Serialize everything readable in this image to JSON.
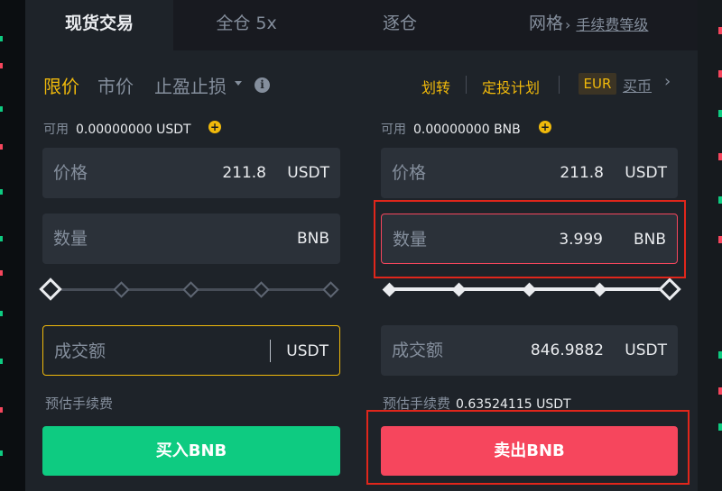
{
  "colors": {
    "accent": "#f0b90b",
    "buy": "#0ecb81",
    "sell": "#f6465d",
    "annotation": "#e0261b"
  },
  "tabs": [
    {
      "label": "现货交易",
      "active": true
    },
    {
      "label": "全仓 5x",
      "active": false
    },
    {
      "label": "逐仓",
      "active": false
    },
    {
      "label": "网格",
      "active": false
    }
  ],
  "fee_level_label": "手续费等级",
  "order_types": [
    {
      "label": "限价",
      "active": true
    },
    {
      "label": "市价",
      "active": false
    },
    {
      "label": "止盈止损",
      "active": false
    }
  ],
  "links": {
    "transfer": "划转",
    "recurring": "定投计划",
    "currency": "EUR",
    "buy_crypto": "买币"
  },
  "buy": {
    "available_label": "可用",
    "available_value": "0.00000000 USDT",
    "price": {
      "label": "价格",
      "value": "211.8",
      "unit": "USDT"
    },
    "amount": {
      "label": "数量",
      "value": "",
      "unit": "BNB"
    },
    "total": {
      "label": "成交额",
      "value": "",
      "unit": "USDT"
    },
    "slider_percent": 0,
    "fee_label": "预估手续费",
    "fee_value": "",
    "button_label": "买入BNB"
  },
  "sell": {
    "available_label": "可用",
    "available_value": "0.00000000 BNB",
    "price": {
      "label": "价格",
      "value": "211.8",
      "unit": "USDT"
    },
    "amount": {
      "label": "数量",
      "value": "3.999",
      "unit": "BNB"
    },
    "total": {
      "label": "成交额",
      "value": "846.9882",
      "unit": "USDT"
    },
    "slider_percent": 100,
    "fee_label": "预估手续费",
    "fee_value": "0.63524115 USDT",
    "button_label": "卖出BNB"
  },
  "icons": {
    "info": "info-icon",
    "add": "plus-circle-icon",
    "dropdown": "caret-down-icon",
    "chevron": "chevron-right-icon"
  }
}
